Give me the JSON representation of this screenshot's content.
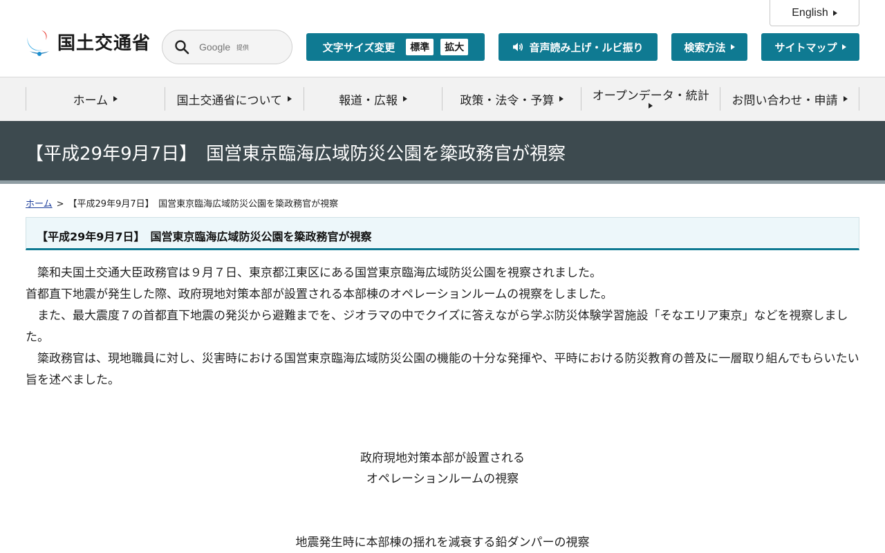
{
  "header": {
    "logo_text": "国土交通省",
    "search": {
      "placeholder": "Google",
      "provided": "提供"
    },
    "english_link": "English",
    "font_size": {
      "label": "文字サイズ変更",
      "standard": "標準",
      "large": "拡大"
    },
    "voice_label": "音声読み上げ・ルビ振り",
    "search_method_label": "検索方法",
    "sitemap_label": "サイトマップ"
  },
  "nav": {
    "items": [
      {
        "label": "ホーム"
      },
      {
        "label": "国土交通省について"
      },
      {
        "label": "報道・広報"
      },
      {
        "label": "政策・法令・予算"
      },
      {
        "label": "オープンデータ・統計"
      },
      {
        "label": "お問い合わせ・申請"
      }
    ]
  },
  "page": {
    "title": "【平成29年9月7日】　国営東京臨海広域防災公園を簗政務官が視察",
    "breadcrumb": {
      "home": "ホーム",
      "separator": ">",
      "current": "【平成29年9月7日】　国営東京臨海広域防災公園を簗政務官が視察"
    },
    "section_heading": "【平成29年9月7日】　国営東京臨海広域防災公園を簗政務官が視察",
    "paragraphs": [
      "　簗和夫国土交通大臣政務官は９月７日、東京都江東区にある国営東京臨海広域防災公園を視察されました。",
      "首都直下地震が発生した際、政府現地対策本部が設置される本部棟のオペレーションルームの視察をしました。",
      "　また、最大震度７の首都直下地震の発災から避難までを、ジオラマの中でクイズに答えながら学ぶ防災体験学習施設「そなエリア東京」などを視察しました。",
      "　簗政務官は、現地職員に対し、災害時における国営東京臨海広域防災公園の機能の十分な発揮や、平時における防災教育の普及に一層取り組んでもらいたい旨を述べました。"
    ],
    "caption1_line1": "政府現地対策本部が設置される",
    "caption1_line2": "オペレーションルームの視察",
    "caption2": "地震発生時に本部棟の揺れを減衰する鉛ダンパーの視察"
  },
  "colors": {
    "accent": "#0f7a92",
    "banner": "#3d4a4f",
    "nav_bg": "#f2f2f2"
  }
}
